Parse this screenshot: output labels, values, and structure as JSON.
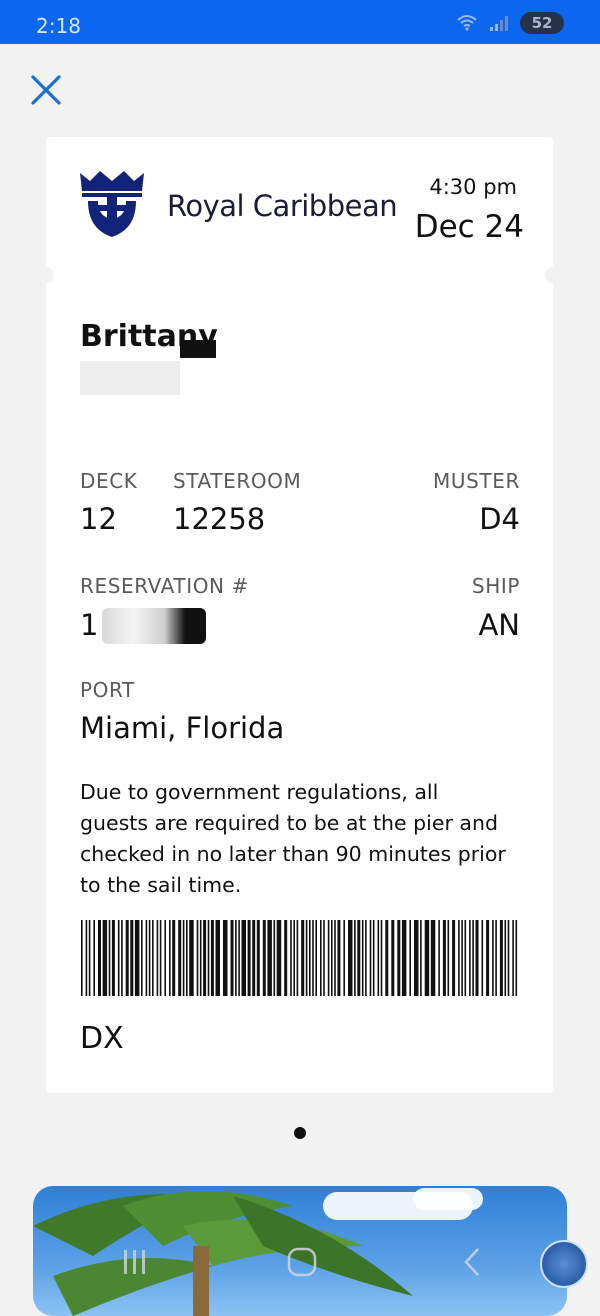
{
  "status_bar": {
    "time": "2:18",
    "battery": "52",
    "icons": [
      "wifi-icon",
      "signal-icon",
      "battery-icon"
    ]
  },
  "header": {
    "close_icon": "close-icon"
  },
  "pass": {
    "brand": "Royal Caribbean",
    "time": "4:30 pm",
    "date": "Dec 24",
    "guest_name": "Brittany",
    "deck_label": "DECK",
    "deck": "12",
    "stateroom_label": "STATEROOM",
    "stateroom": "12258",
    "muster_label": "MUSTER",
    "muster": "D4",
    "reservation_label": "RESERVATION #",
    "reservation_partial": "1",
    "ship_label": "SHIP",
    "ship": "AN",
    "port_label": "PORT",
    "port": "Miami, Florida",
    "notice": "Due to government regulations, all guests are required to be at the pier and checked in no later than 90 minutes prior to the sail time.",
    "code": "DX"
  },
  "pager": {
    "current": 1,
    "total": 1
  },
  "nav": {
    "icons": [
      "recents-icon",
      "home-icon",
      "back-icon"
    ]
  },
  "colors": {
    "status_bar": "#0b66f0",
    "accent": "#1a6fd8",
    "brand_navy": "#13237a"
  }
}
